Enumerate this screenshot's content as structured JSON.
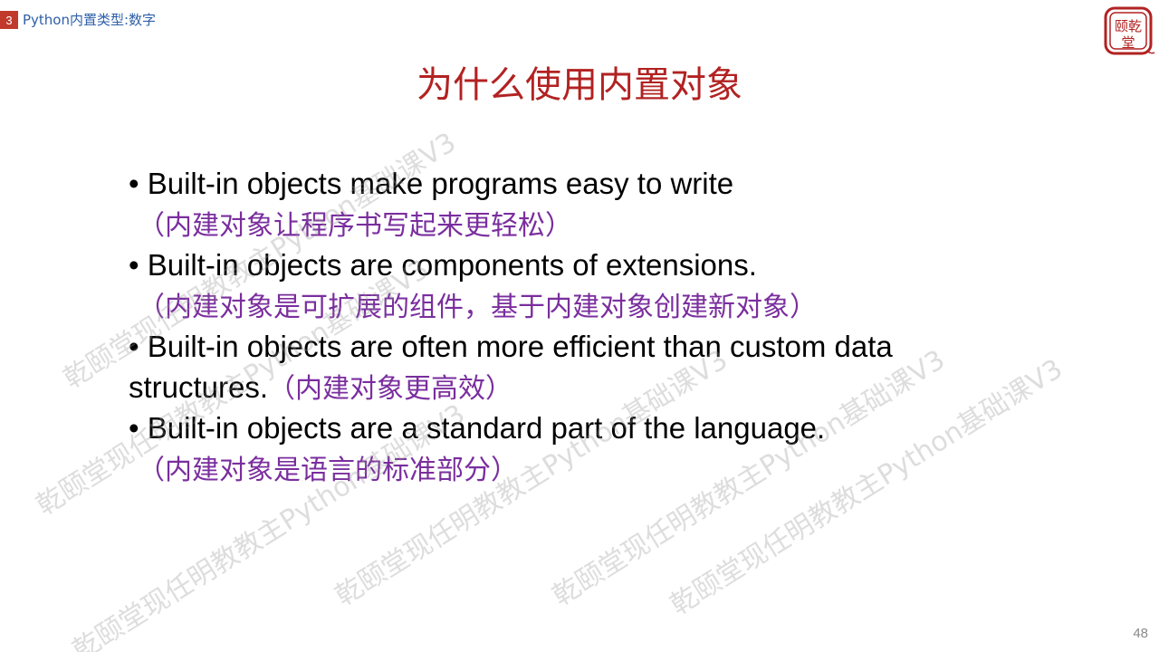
{
  "header": {
    "chapter_number": "3",
    "chapter_title": "Python内置类型:数字"
  },
  "logo": {
    "text": "颐乾堂",
    "icon": "seal-logo",
    "color": "#b22222"
  },
  "title": "为什么使用内置对象",
  "bullets": [
    {
      "en": "• Built-in objects make programs easy to write",
      "zh": "（内建对象让程序书写起来更轻松）"
    },
    {
      "en": "• Built-in objects are components of extensions.",
      "zh": "（内建对象是可扩展的组件，基于内建对象创建新对象）"
    },
    {
      "en_line1": "• Built-in objects are often more efficient than custom data",
      "en_line2": "structures.",
      "zh": "（内建对象更高效）"
    },
    {
      "en": "• Built-in objects are a standard part of the language.",
      "zh": "（内建对象是语言的标准部分）"
    }
  ],
  "watermark": {
    "text_a": "乾颐堂现任明教教主Python基础课V3",
    "text_b": "乾颐堂现任明教教主Python基础课V3"
  },
  "page_number": "48",
  "colors": {
    "title": "#b22222",
    "chapter_badge": "#c0392b",
    "chapter_text": "#2e5fa8",
    "chinese_text": "#7a2e9e"
  }
}
